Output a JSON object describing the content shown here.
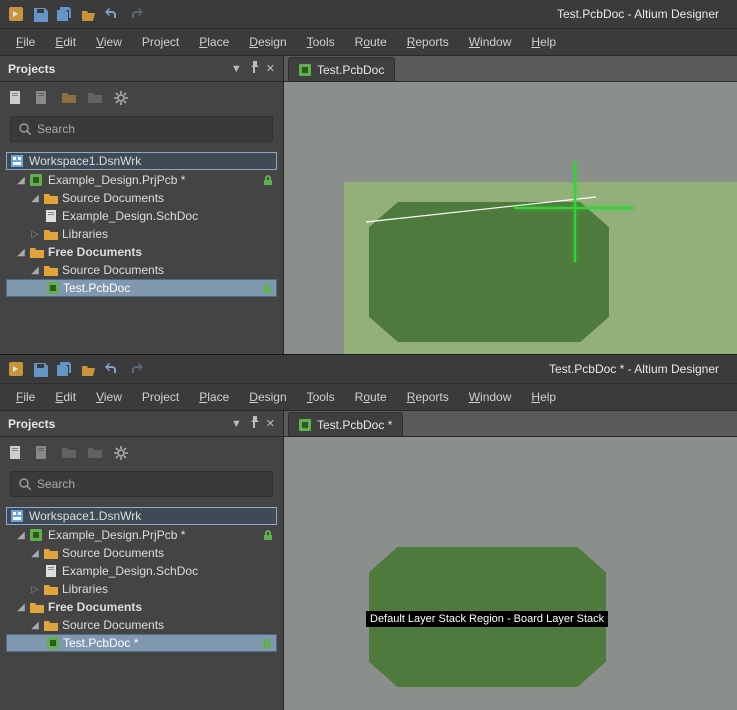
{
  "instances": [
    {
      "title": "Test.PcbDoc - Altium Designer",
      "tabLabel": "Test.PcbDoc",
      "documentName": "Test.PcbDoc",
      "searchPlaceholder": "Search",
      "boardLabel": null
    },
    {
      "title": "Test.PcbDoc * - Altium Designer",
      "tabLabel": "Test.PcbDoc *",
      "documentName": "Test.PcbDoc *",
      "searchPlaceholder": "Search",
      "boardLabel": "Default Layer Stack Region - Board Layer Stack"
    }
  ],
  "menu": {
    "file": "File",
    "edit": "Edit",
    "view": "View",
    "project": "Project",
    "place": "Place",
    "design": "Design",
    "tools": "Tools",
    "route": "Route",
    "reports": "Reports",
    "window": "Window",
    "help": "Help"
  },
  "panel": {
    "title": "Projects",
    "workspace": "Workspace1.DsnWrk",
    "project": "Example_Design.PrjPcb *",
    "sourceDocs": "Source Documents",
    "schDoc": "Example_Design.SchDoc",
    "libraries": "Libraries",
    "freeDocs": "Free Documents"
  }
}
